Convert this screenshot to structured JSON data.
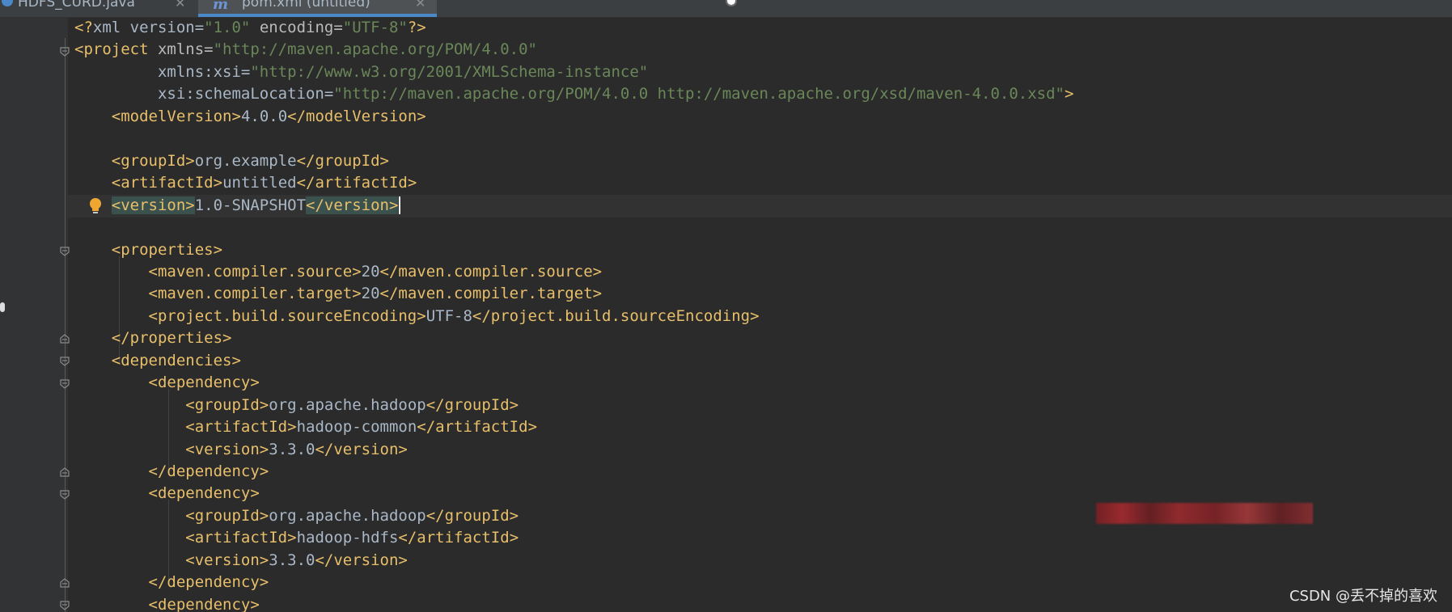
{
  "tabs": [
    {
      "label": "HDFS_CURD.java",
      "icon": "java-file-icon",
      "active": false
    },
    {
      "label": "pom.xml (untitled)",
      "icon": "maven-m-icon",
      "active": true
    }
  ],
  "colors": {
    "background": "#2b2b2b",
    "tag": "#e8bf6a",
    "attribute": "#bababa",
    "string": "#6a8759",
    "text": "#a9b7c6",
    "active_tab_accent": "#4a88c7"
  },
  "editor": {
    "lines": [
      "<?xml version=\"1.0\" encoding=\"UTF-8\"?>",
      "<project xmlns=\"http://maven.apache.org/POM/4.0.0\"",
      "         xmlns:xsi=\"http://www.w3.org/2001/XMLSchema-instance\"",
      "         xsi:schemaLocation=\"http://maven.apache.org/POM/4.0.0 http://maven.apache.org/xsd/maven-4.0.0.xsd\">",
      "    <modelVersion>4.0.0</modelVersion>",
      "",
      "    <groupId>org.example</groupId>",
      "    <artifactId>untitled</artifactId>",
      "    <version>1.0-SNAPSHOT</version>",
      "",
      "    <properties>",
      "        <maven.compiler.source>20</maven.compiler.source>",
      "        <maven.compiler.target>20</maven.compiler.target>",
      "        <project.build.sourceEncoding>UTF-8</project.build.sourceEncoding>",
      "    </properties>",
      "    <dependencies>",
      "        <dependency>",
      "            <groupId>org.apache.hadoop</groupId>",
      "            <artifactId>hadoop-common</artifactId>",
      "            <version>3.3.0</version>",
      "        </dependency>",
      "        <dependency>",
      "            <groupId>org.apache.hadoop</groupId>",
      "            <artifactId>hadoop-hdfs</artifactId>",
      "            <version>3.3.0</version>",
      "        </dependency>",
      "        <dependency>"
    ],
    "caret_line_index": 8
  },
  "watermark": "CSDN @丢不掉的喜欢"
}
